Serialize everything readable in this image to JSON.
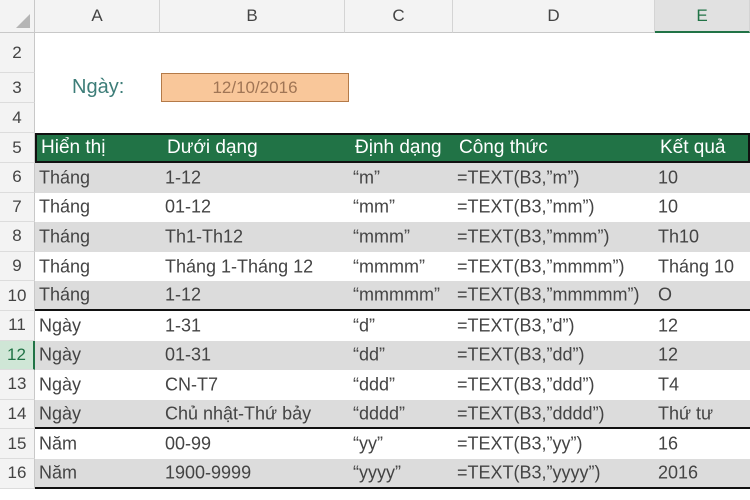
{
  "columns": [
    "A",
    "B",
    "C",
    "D",
    "E"
  ],
  "selected_column": "E",
  "row_numbers": [
    "2",
    "3",
    "4",
    "5",
    "6",
    "7",
    "8",
    "9",
    "10",
    "11",
    "12",
    "13",
    "14",
    "15",
    "16"
  ],
  "selected_row": "12",
  "date_label": "Ngày:",
  "date_value": "12/10/2016",
  "colors": {
    "header_green": "#217346",
    "date_fill": "#f9c79a",
    "stripe": "#dcdcdc"
  },
  "table": {
    "headers": [
      "Hiển thị",
      "Dưới dạng",
      "Định dạng",
      "Công thức",
      "Kết quả"
    ],
    "rows": [
      [
        "Tháng",
        "1-12",
        "“m”",
        "=TEXT(B3,”m”)",
        "10"
      ],
      [
        "Tháng",
        "01-12",
        "“mm”",
        "=TEXT(B3,”mm”)",
        "10"
      ],
      [
        "Tháng",
        "Th1-Th12",
        "“mmm”",
        "=TEXT(B3,”mmm”)",
        "Th10"
      ],
      [
        "Tháng",
        "Tháng 1-Tháng 12",
        "“mmmm”",
        "=TEXT(B3,”mmmm”)",
        "Tháng 10"
      ],
      [
        "Tháng",
        "1-12",
        "“mmmmm”",
        "=TEXT(B3,”mmmmm”)",
        "O"
      ],
      [
        "Ngày",
        "1-31",
        "“d”",
        "=TEXT(B3,”d”)",
        "12"
      ],
      [
        "Ngày",
        "01-31",
        "“dd”",
        "=TEXT(B3,”dd”)",
        "12"
      ],
      [
        "Ngày",
        "CN-T7",
        "“ddd”",
        "=TEXT(B3,”ddd”)",
        "T4"
      ],
      [
        "Ngày",
        "Chủ nhật-Thứ bảy",
        "“dddd”",
        "=TEXT(B3,”dddd”)",
        "Thứ tư"
      ],
      [
        "Năm",
        "00-99",
        "“yy”",
        "=TEXT(B3,”yy”)",
        "16"
      ],
      [
        "Năm",
        "1900-9999",
        "“yyyy”",
        "=TEXT(B3,”yyyy”)",
        "2016"
      ]
    ]
  }
}
